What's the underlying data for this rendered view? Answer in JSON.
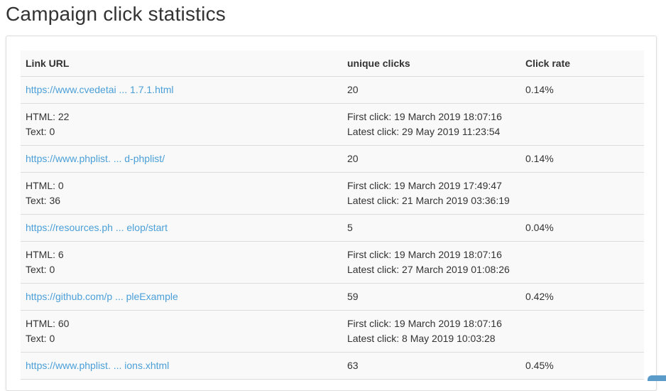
{
  "page": {
    "title": "Campaign click statistics"
  },
  "table": {
    "headers": {
      "url": "Link URL",
      "clicks": "unique clicks",
      "rate": "Click rate"
    },
    "rows": [
      {
        "url": "https://www.cvedetai ... 1.7.1.html",
        "clicks": "20",
        "rate": "0.14%",
        "html": "HTML: 22",
        "text": "Text: 0",
        "first": "First click: 19 March 2019 18:07:16",
        "latest": "Latest click: 29 May 2019 11:23:54"
      },
      {
        "url": "https://www.phplist. ... d-phplist/",
        "clicks": "20",
        "rate": "0.14%",
        "html": "HTML: 0",
        "text": "Text: 36",
        "first": "First click: 19 March 2019 17:49:47",
        "latest": "Latest click: 21 March 2019 03:36:19"
      },
      {
        "url": "https://resources.ph ... elop/start",
        "clicks": "5",
        "rate": "0.04%",
        "html": "HTML: 6",
        "text": "Text: 0",
        "first": "First click: 19 March 2019 18:07:16",
        "latest": "Latest click: 27 March 2019 01:08:26"
      },
      {
        "url": "https://github.com/p ... pleExample",
        "clicks": "59",
        "rate": "0.42%",
        "html": "HTML: 60",
        "text": "Text: 0",
        "first": "First click: 19 March 2019 18:07:16",
        "latest": "Latest click: 8 May 2019 10:03:28"
      },
      {
        "url": "https://www.phplist. ... ions.xhtml",
        "clicks": "63",
        "rate": "0.45%"
      }
    ]
  },
  "colors": {
    "link": "#4a9fd8",
    "border": "#dddddd",
    "row_bg": "#f9f9f9",
    "badge": "#5b9bc9"
  }
}
